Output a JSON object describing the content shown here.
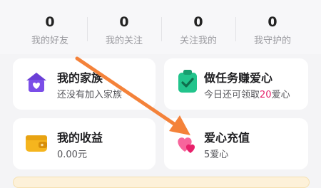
{
  "stats": [
    {
      "value": "0",
      "label": "我的好友"
    },
    {
      "value": "0",
      "label": "我的关注"
    },
    {
      "value": "0",
      "label": "关注我的"
    },
    {
      "value": "0",
      "label": "我守护的"
    }
  ],
  "cards": {
    "family": {
      "title": "我的家族",
      "subtitle": "还没有加入家族"
    },
    "tasks": {
      "title": "做任务赚爱心",
      "subtitle_prefix": "今日还可领取",
      "subtitle_highlight": "20",
      "subtitle_suffix": "爱心"
    },
    "earnings": {
      "title": "我的收益",
      "subtitle": "0.00元"
    },
    "recharge": {
      "title": "爱心充值",
      "subtitle": "5爱心"
    }
  },
  "colors": {
    "accent_pink": "#e4206a",
    "arrow": "#f4823a",
    "family_icon": "#7b4ee8",
    "tasks_icon": "#22c48c",
    "earnings_icon": "#f5b51e",
    "recharge_icon": "#f0357a"
  },
  "icons": {
    "family": "house-heart-icon",
    "tasks": "clipboard-check-icon",
    "earnings": "wallet-icon",
    "recharge": "hearts-icon"
  }
}
